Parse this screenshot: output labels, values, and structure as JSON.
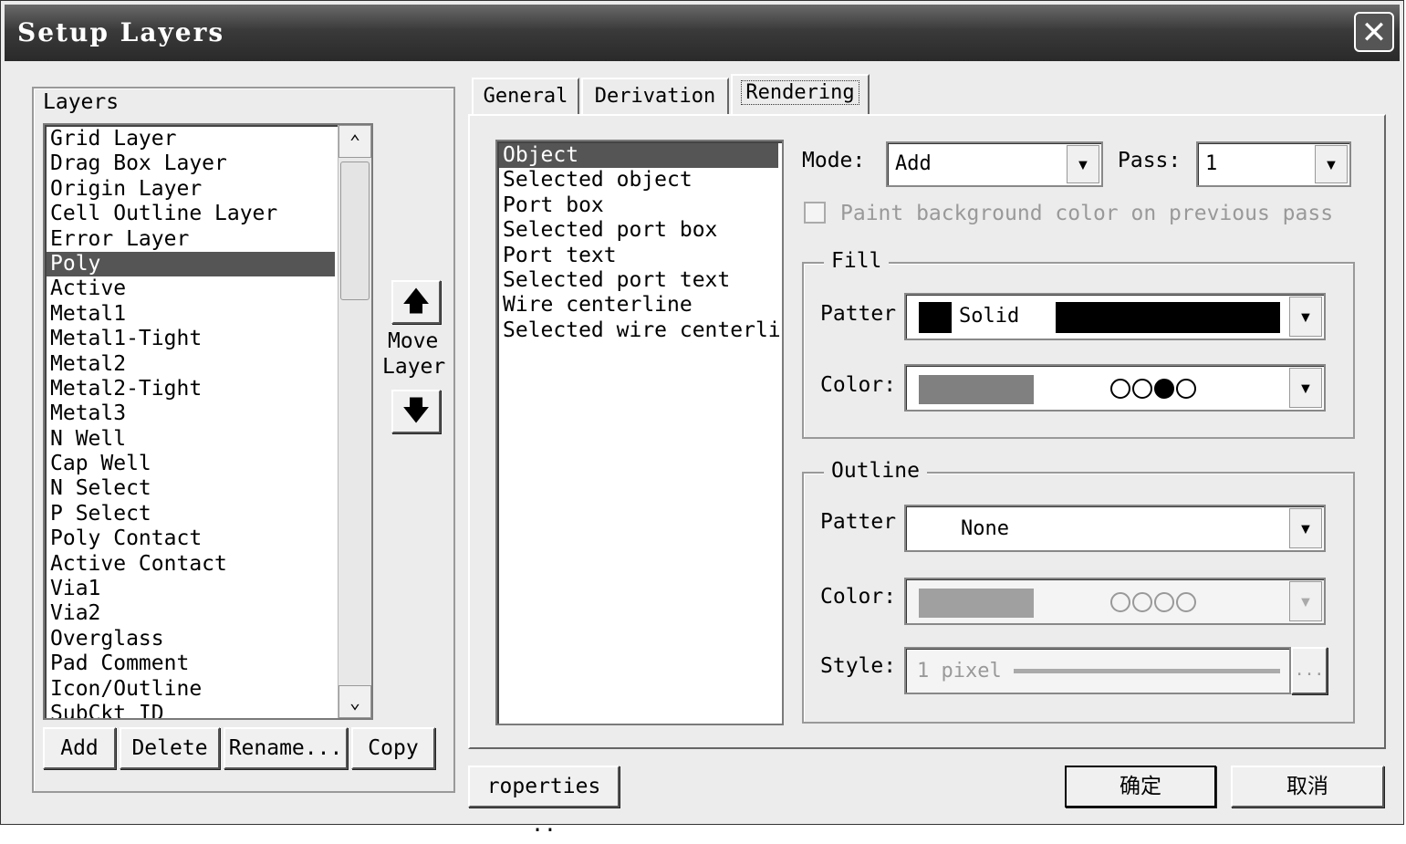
{
  "window": {
    "title": "Setup Layers",
    "close_symbol": "✕"
  },
  "layers": {
    "group_label": "Layers",
    "items": [
      "Grid Layer",
      "Drag Box Layer",
      "Origin Layer",
      "Cell Outline Layer",
      "Error Layer",
      "Poly",
      "Active",
      "Metal1",
      "Metal1-Tight",
      "Metal2",
      "Metal2-Tight",
      "Metal3",
      "N Well",
      "Cap Well",
      "N Select",
      "P Select",
      "Poly Contact",
      "Active Contact",
      "Via1",
      "Via2",
      "Overglass",
      "Pad Comment",
      "Icon/Outline",
      "SubCkt ID"
    ],
    "selected": "Poly",
    "buttons": {
      "add": "Add",
      "delete": "Delete",
      "rename": "Rename...",
      "copy": "Copy"
    }
  },
  "move_layer": {
    "label_line1": "Move",
    "label_line2": "Layer",
    "up_symbol": "🡅",
    "down_symbol": "🡇"
  },
  "tabs": [
    "General",
    "Derivation",
    "Rendering"
  ],
  "active_tab": "Rendering",
  "rendering": {
    "objects": [
      "Object",
      "Selected object",
      "Port box",
      "Selected port box",
      "Port text",
      "Selected port text",
      "Wire centerline",
      "Selected wire centerline"
    ],
    "selected_object": "Object",
    "mode_label": "Mode:",
    "mode_value": "Add",
    "pass_label": "Pass:",
    "pass_value": "1",
    "paint_bg_label": "Paint background color on previous pass",
    "fill": {
      "group_label": "Fill",
      "pattern_label": "Patter",
      "pattern_value": "Solid",
      "color_label": "Color:",
      "color_swatch": "#808080",
      "color_dots": [
        false,
        false,
        true,
        false
      ]
    },
    "outline": {
      "group_label": "Outline",
      "pattern_label": "Patter",
      "pattern_value": "None",
      "color_label": "Color:",
      "color_swatch": "#a0a0a0",
      "color_dots": [
        false,
        false,
        false,
        false
      ],
      "style_label": "Style:",
      "style_value": "1 pixel",
      "style_button": "..."
    }
  },
  "footer": {
    "properties": "roperties ..",
    "ok": "确定",
    "cancel": "取消"
  }
}
